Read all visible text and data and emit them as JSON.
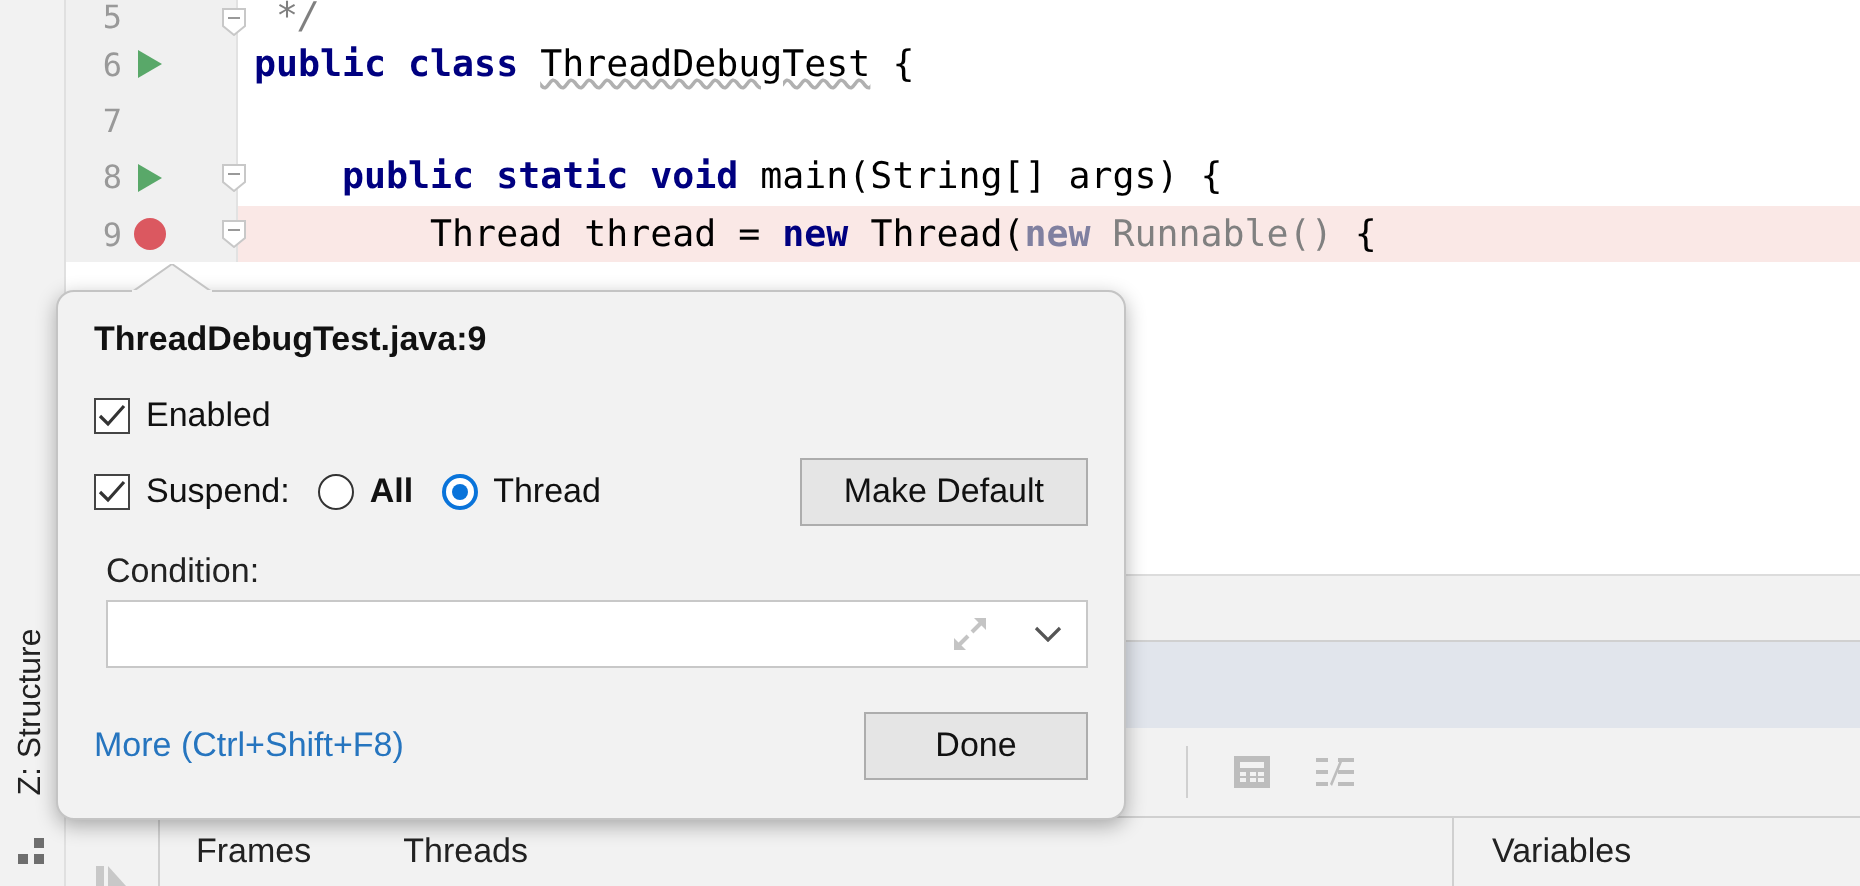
{
  "tool_strip": {
    "label": "Z: Structure"
  },
  "editor": {
    "lines": [
      {
        "number": "5",
        "run": false,
        "fold": true,
        "breakpoint": false,
        "tokens": [
          {
            "kind": "comment",
            "text": " */"
          }
        ]
      },
      {
        "number": "6",
        "run": true,
        "fold": false,
        "breakpoint": false,
        "tokens": [
          {
            "kind": "kw",
            "text": "public class "
          },
          {
            "kind": "typo",
            "text": "ThreadDebugTest"
          },
          {
            "kind": "plain",
            "text": " {"
          }
        ]
      },
      {
        "number": "7",
        "run": false,
        "fold": false,
        "breakpoint": false
      },
      {
        "number": "8",
        "run": true,
        "fold": true,
        "breakpoint": false,
        "tokens": [
          {
            "kind": "kw",
            "text": "    public static void "
          },
          {
            "kind": "plain",
            "text": "main(String[] args) {"
          }
        ]
      },
      {
        "number": "9",
        "run": false,
        "fold": true,
        "breakpoint": true,
        "tokens": [
          {
            "kind": "plain",
            "text": "        Thread thread = "
          },
          {
            "kind": "kw",
            "text": "new "
          },
          {
            "kind": "plain",
            "text": "Thread("
          },
          {
            "kind": "dimkw",
            "text": "new "
          },
          {
            "kind": "dim",
            "text": "Runnable()"
          },
          {
            "kind": "plain",
            "text": " {"
          }
        ]
      }
    ]
  },
  "popup": {
    "title": "ThreadDebugTest.java:9",
    "enabled": {
      "label": "Enabled",
      "checked": true
    },
    "suspend": {
      "label": "Suspend:",
      "checked": true,
      "options": [
        {
          "label": "All",
          "selected": false,
          "emphasized": true
        },
        {
          "label": "Thread",
          "selected": true,
          "emphasized": false
        }
      ]
    },
    "make_default": "Make Default",
    "condition_label": "Condition:",
    "more_link": "More (Ctrl+Shift+F8)",
    "done": "Done"
  },
  "debug_panel": {
    "tabs": [
      {
        "label": "Frames"
      },
      {
        "label": "Threads"
      }
    ],
    "variables_header": "Variables"
  }
}
